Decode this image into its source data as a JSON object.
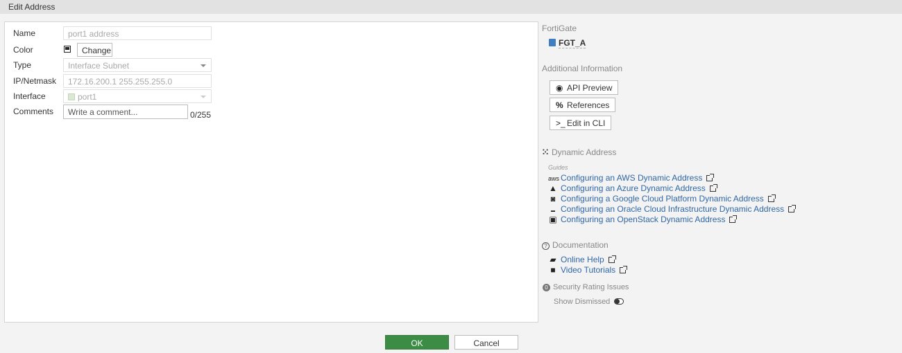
{
  "window": {
    "title": "Edit Address"
  },
  "form": {
    "name": {
      "label": "Name",
      "value": "port1 address"
    },
    "color": {
      "label": "Color",
      "button": "Change"
    },
    "type": {
      "label": "Type",
      "value": "Interface Subnet"
    },
    "ip_netmask": {
      "label": "IP/Netmask",
      "value": "172.16.200.1 255.255.255.0"
    },
    "interface": {
      "label": "Interface",
      "value": "port1"
    },
    "comments": {
      "label": "Comments",
      "placeholder": "Write a comment...",
      "counter": "0/255"
    }
  },
  "sidebar": {
    "fortigate": {
      "title": "FortiGate",
      "device": "FGT_A"
    },
    "additional": {
      "title": "Additional Information",
      "buttons": [
        "API Preview",
        "References",
        "Edit in CLI"
      ]
    },
    "dynamic": {
      "title": "Dynamic Address",
      "guides_label": "Guides",
      "links": [
        {
          "icon": "aws-icon",
          "label": "Configuring an AWS Dynamic Address"
        },
        {
          "icon": "azure-icon",
          "label": "Configuring an Azure Dynamic Address"
        },
        {
          "icon": "gcp-icon",
          "label": "Configuring a Google Cloud Platform Dynamic Address"
        },
        {
          "icon": "oracle-icon",
          "label": "Configuring an Oracle Cloud Infrastructure Dynamic Address"
        },
        {
          "icon": "openstack-icon",
          "label": "Configuring an OpenStack Dynamic Address"
        }
      ]
    },
    "documentation": {
      "title": "Documentation",
      "links": [
        {
          "icon": "book-icon",
          "label": "Online Help"
        },
        {
          "icon": "video-icon",
          "label": "Video Tutorials"
        }
      ]
    },
    "security": {
      "title": "Security Rating Issues",
      "toggle_label": "Show Dismissed"
    }
  },
  "footer": {
    "ok": "OK",
    "cancel": "Cancel"
  },
  "colors": {
    "accent": "#3c8c45",
    "link": "#2f67a6"
  }
}
